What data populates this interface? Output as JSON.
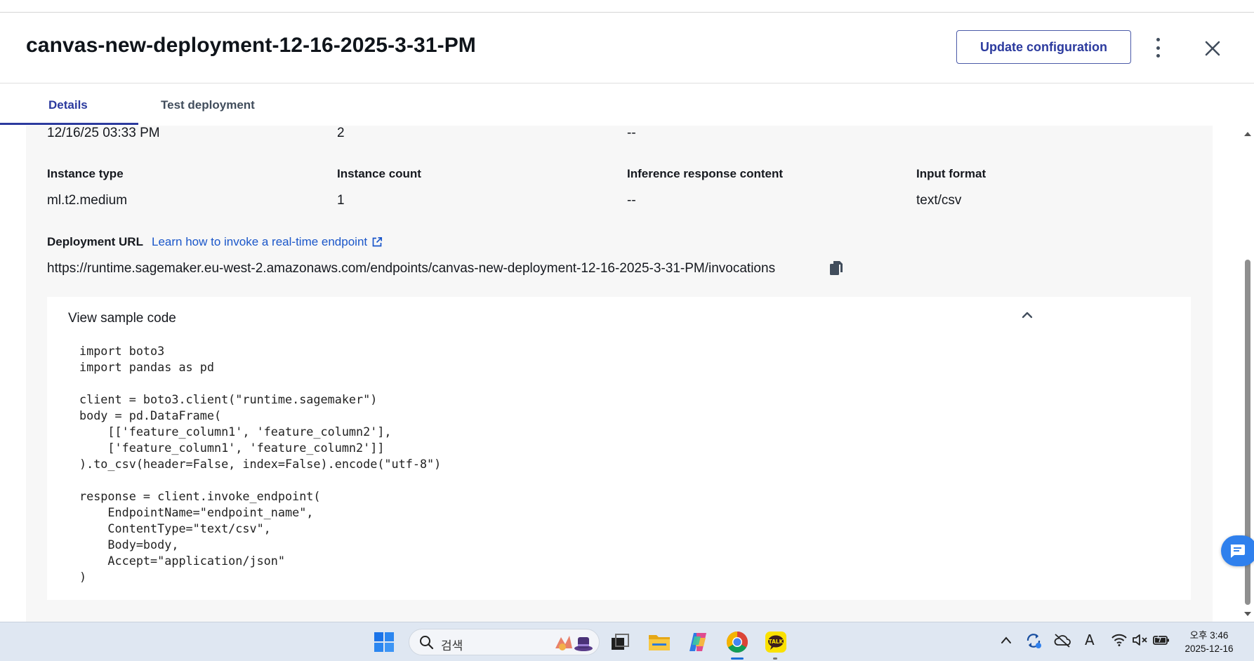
{
  "header": {
    "title": "canvas-new-deployment-12-16-2025-3-31-PM",
    "update_button": "Update configuration"
  },
  "tabs": [
    {
      "label": "Details",
      "active": true
    },
    {
      "label": "Test deployment",
      "active": false
    }
  ],
  "details": {
    "prev_row": [
      "12/16/25 03:33 PM",
      "2",
      "--"
    ],
    "fields": [
      {
        "label": "Instance type",
        "value": "ml.t2.medium"
      },
      {
        "label": "Instance count",
        "value": "1"
      },
      {
        "label": "Inference response content",
        "value": "--"
      },
      {
        "label": "Input format",
        "value": "text/csv"
      }
    ],
    "deployment_url_label": "Deployment URL",
    "learn_link": "Learn how to invoke a real-time endpoint",
    "url": "https://runtime.sagemaker.eu-west-2.amazonaws.com/endpoints/canvas-new-deployment-12-16-2025-3-31-PM/invocations"
  },
  "sample_code": {
    "title": "View sample code",
    "code": "import boto3\nimport pandas as pd\n\nclient = boto3.client(\"runtime.sagemaker\")\nbody = pd.DataFrame(\n    [['feature_column1', 'feature_column2'],\n    ['feature_column1', 'feature_column2']]\n).to_csv(header=False, index=False).encode(\"utf-8\")\n\nresponse = client.invoke_endpoint(\n    EndpointName=\"endpoint_name\",\n    ContentType=\"text/csv\",\n    Body=body,\n    Accept=\"application/json\"\n)"
  },
  "taskbar": {
    "search_placeholder": "검색",
    "clock_time": "오후 3:46",
    "clock_date": "2025-12-16",
    "ime_label": "A"
  },
  "colors": {
    "accent": "#2b3a9e",
    "link": "#1a56c9",
    "panel_bg": "#f7f7f7",
    "chat_bubble": "#2f80ed"
  }
}
